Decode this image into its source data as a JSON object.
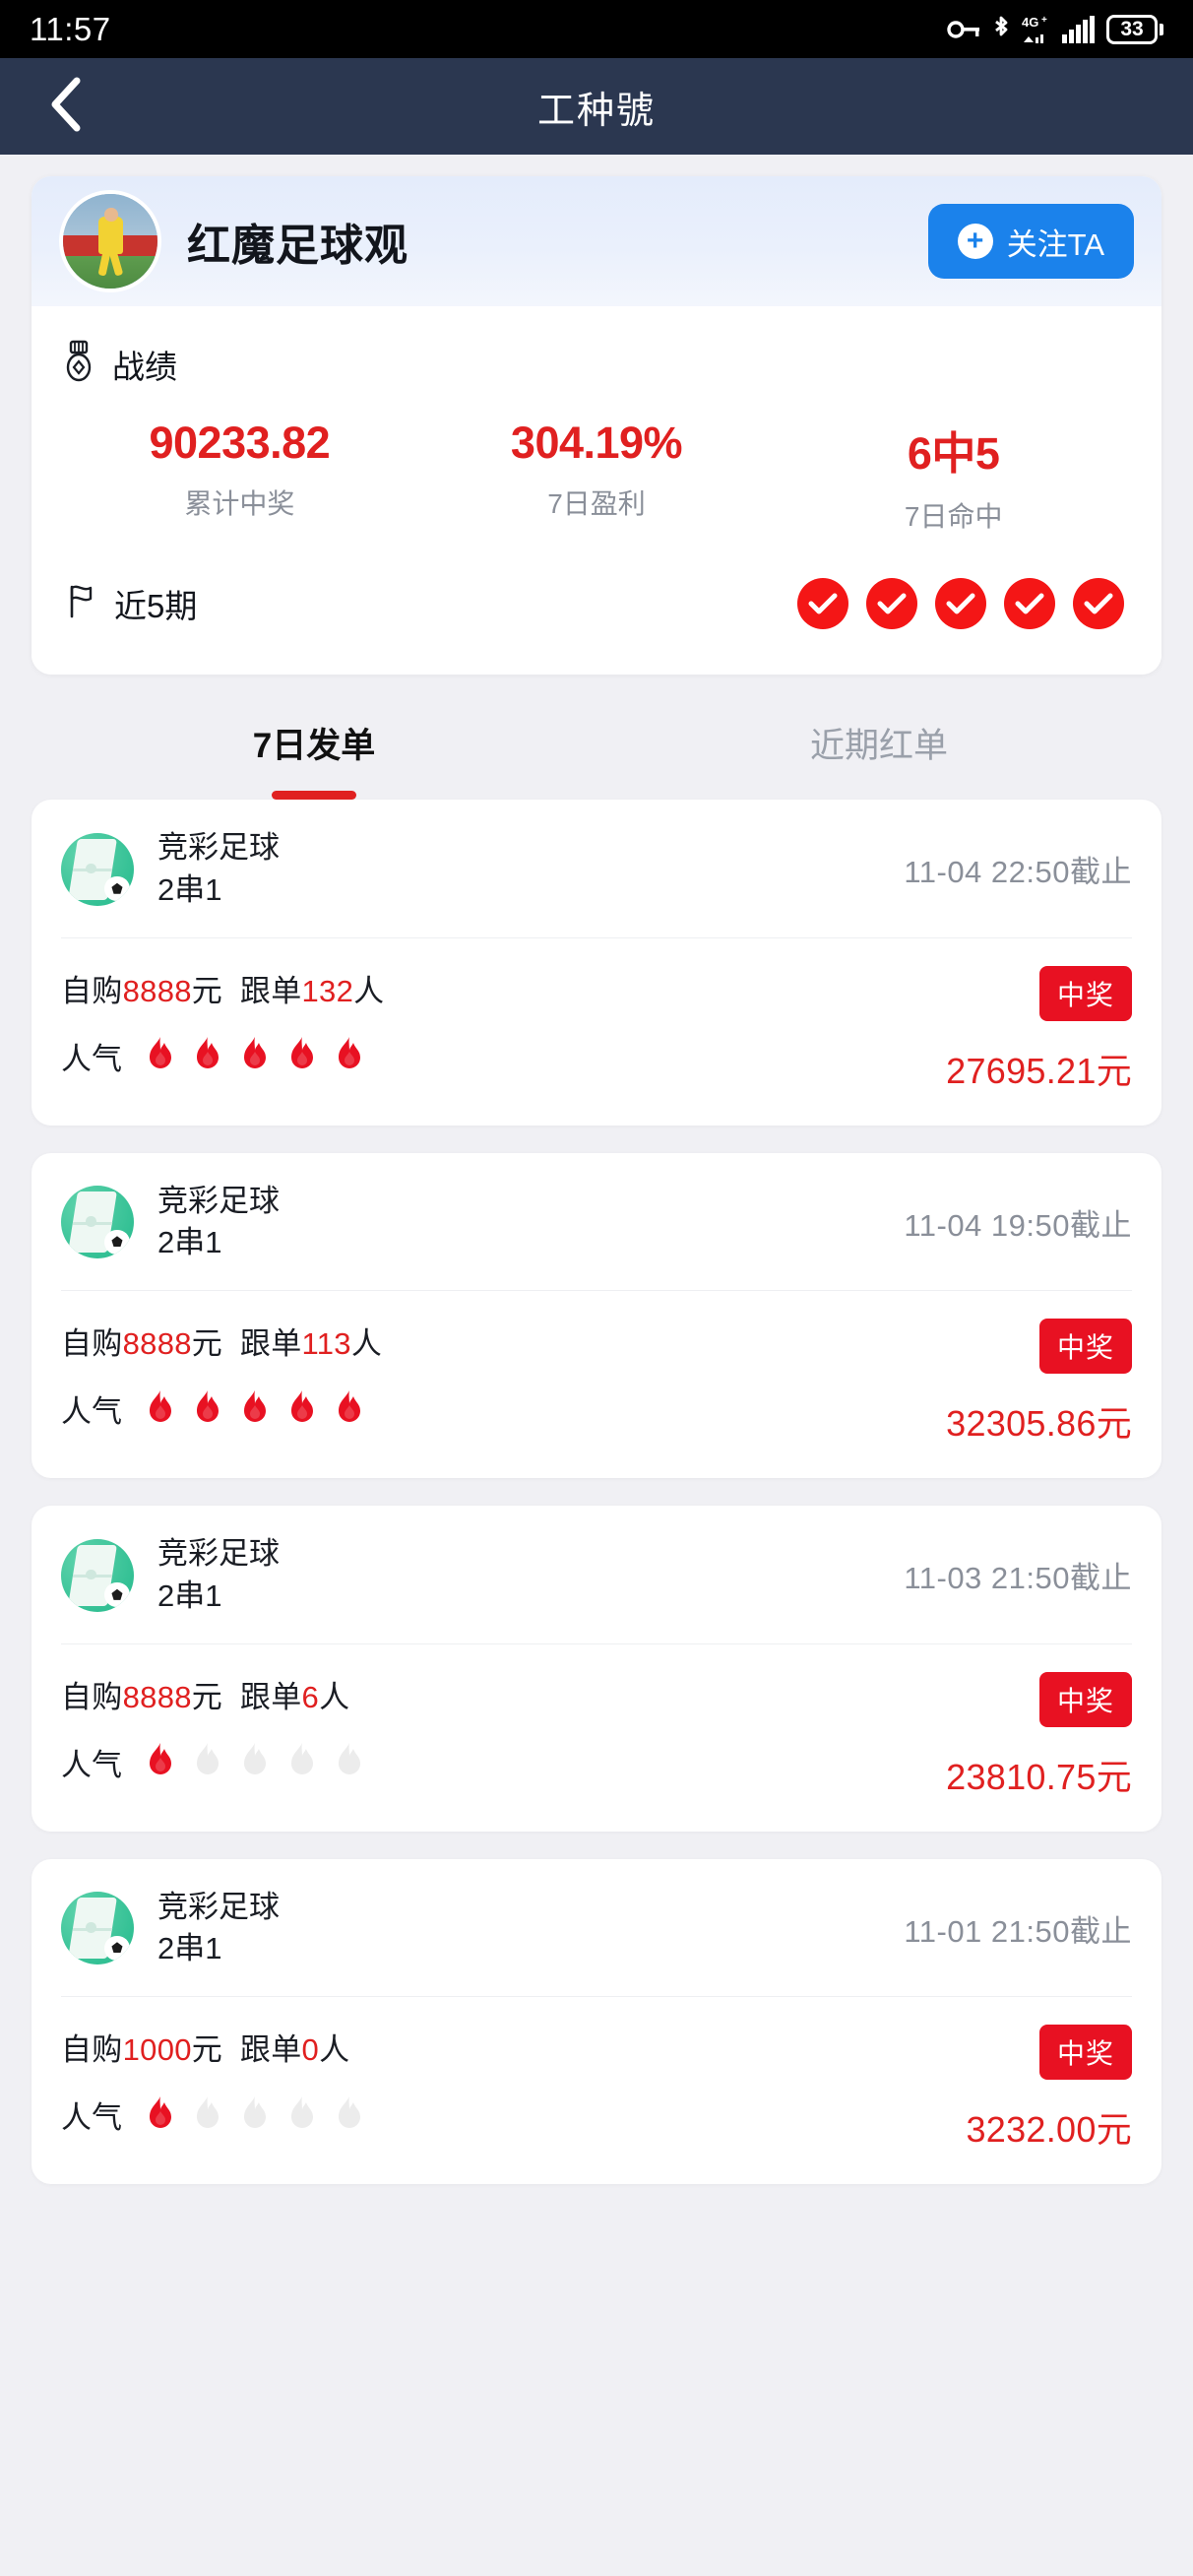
{
  "status_bar": {
    "time": "11:57",
    "battery": "33",
    "network": "4G+",
    "icons": [
      "key-icon",
      "bluetooth-icon",
      "network-4g-icon",
      "signal-bars-icon",
      "battery-icon"
    ]
  },
  "nav": {
    "title": "工种號",
    "back_icon": "chevron-left-icon"
  },
  "profile": {
    "name": "红魔足球观",
    "avatar_icon": "user-avatar-photo",
    "follow_label": "关注TA",
    "follow_plus": "+",
    "follow_color": "#1b82eb"
  },
  "record": {
    "section_icon": "medal-icon",
    "section_label": "战绩",
    "stats": [
      {
        "value": "90233.82",
        "caption": "累计中奖"
      },
      {
        "value": "304.19%",
        "caption": "7日盈利"
      },
      {
        "value": "6中5",
        "caption": "7日命中"
      }
    ],
    "recent": {
      "icon": "flag-icon",
      "label": "近5期",
      "results": [
        "win",
        "win",
        "win",
        "win",
        "win"
      ],
      "marker_color": "#f41616"
    }
  },
  "tabs": [
    {
      "label": "7日发单",
      "active": true
    },
    {
      "label": "近期红单",
      "active": false
    }
  ],
  "bets": [
    {
      "game": "竞彩足球",
      "play_type": "2串1",
      "deadline": "11-04 22:50截止",
      "self_buy_prefix": "自购",
      "self_buy_amount": "8888",
      "self_buy_unit": "元",
      "follow_prefix": "跟单",
      "follow_count": "132",
      "follow_unit": "人",
      "popularity_label": "人气",
      "popularity": 5,
      "status_badge": "中奖",
      "payout": "27695.21元"
    },
    {
      "game": "竞彩足球",
      "play_type": "2串1",
      "deadline": "11-04 19:50截止",
      "self_buy_prefix": "自购",
      "self_buy_amount": "8888",
      "self_buy_unit": "元",
      "follow_prefix": "跟单",
      "follow_count": "113",
      "follow_unit": "人",
      "popularity_label": "人气",
      "popularity": 5,
      "status_badge": "中奖",
      "payout": "32305.86元"
    },
    {
      "game": "竞彩足球",
      "play_type": "2串1",
      "deadline": "11-03 21:50截止",
      "self_buy_prefix": "自购",
      "self_buy_amount": "8888",
      "self_buy_unit": "元",
      "follow_prefix": "跟单",
      "follow_count": "6",
      "follow_unit": "人",
      "popularity_label": "人气",
      "popularity": 1,
      "status_badge": "中奖",
      "payout": "23810.75元"
    },
    {
      "game": "竞彩足球",
      "play_type": "2串1",
      "deadline": "11-01 21:50截止",
      "self_buy_prefix": "自购",
      "self_buy_amount": "1000",
      "self_buy_unit": "元",
      "follow_prefix": "跟单",
      "follow_count": "0",
      "follow_unit": "人",
      "popularity_label": "人气",
      "popularity": 1,
      "status_badge": "中奖",
      "payout": "3232.00元"
    }
  ],
  "theme": {
    "header_bg": "#2b3750",
    "accent_red": "#e02020",
    "badge_red": "#e81122",
    "page_bg": "#f0f0f4"
  }
}
